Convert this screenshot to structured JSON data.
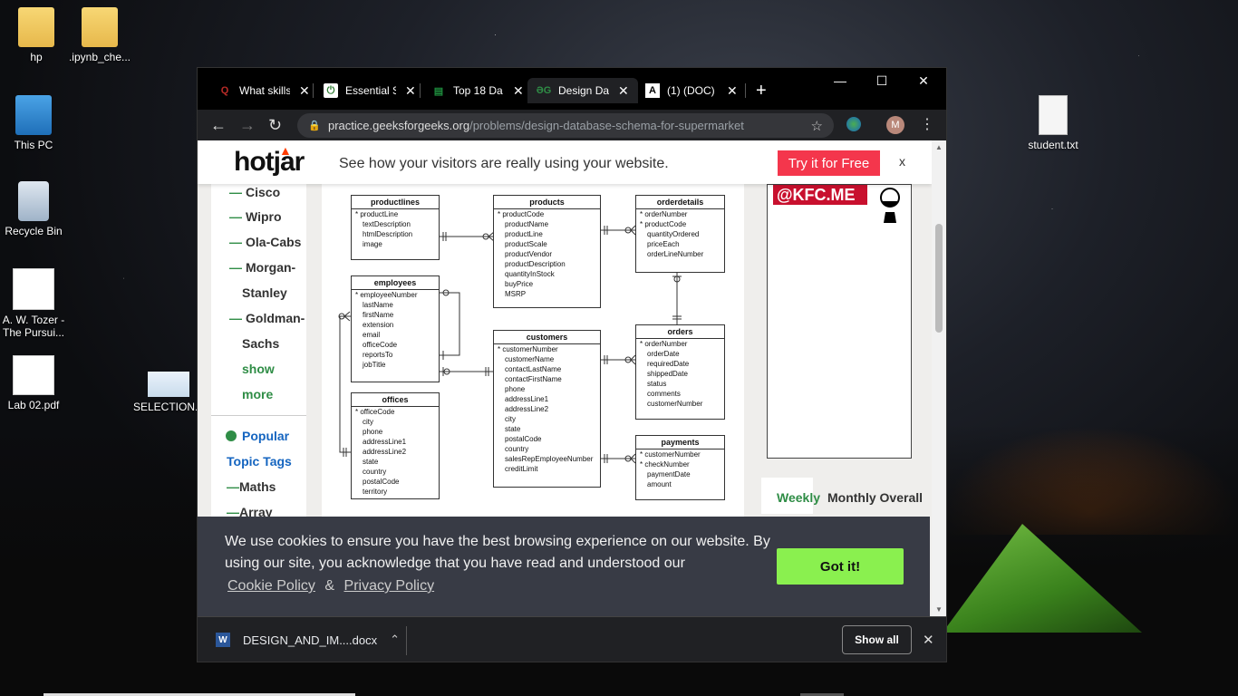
{
  "desktop": {
    "icons": [
      {
        "label": "hp"
      },
      {
        "label": ".ipynb_che..."
      },
      {
        "label": "This PC"
      },
      {
        "label": "Recycle Bin"
      },
      {
        "label": "A. W. Tozer - The Pursui..."
      },
      {
        "label": "Lab 02.pdf"
      },
      {
        "label": "SELECTION..."
      },
      {
        "label": "student.txt"
      }
    ]
  },
  "browser": {
    "tabs": [
      {
        "title": "What skills",
        "favicon": "Q",
        "color": "#b92b27"
      },
      {
        "title": "Essential S",
        "favicon": "⏻",
        "color": "#2e7d32"
      },
      {
        "title": "Top 18 Da",
        "favicon": "▤",
        "color": "#1e8e3e"
      },
      {
        "title": "Design Da",
        "favicon": "ƏG",
        "color": "#2f8d46"
      },
      {
        "title": "(1) (DOC)",
        "favicon": "A",
        "color": "#ffffff"
      }
    ],
    "new_tab": "+",
    "url_host": "practice.geeksforgeeks.org",
    "url_path": "/problems/design-database-schema-for-supermarket",
    "avatar": "M"
  },
  "hotjar": {
    "logo": "hotjar",
    "tagline": "See how your visitors are really using your website.",
    "cta": "Try it for Free",
    "close": "x"
  },
  "sidebar": {
    "companies": [
      "Cisco",
      "Wipro",
      "Ola-Cabs",
      "Morgan-",
      "Stanley",
      "Goldman-",
      "Sachs"
    ],
    "show_more_1": "show",
    "show_more_2": "more",
    "popular_1": "Popular",
    "popular_2": "Topic Tags",
    "topics": [
      "Maths",
      "Array"
    ]
  },
  "erd": {
    "productlines": {
      "title": "productlines",
      "fields": [
        {
          "n": "productLine",
          "pk": true
        },
        {
          "n": "textDescription"
        },
        {
          "n": "htmlDescription"
        },
        {
          "n": "image"
        }
      ]
    },
    "products": {
      "title": "products",
      "fields": [
        {
          "n": "productCode",
          "pk": true
        },
        {
          "n": "productName"
        },
        {
          "n": "productLine"
        },
        {
          "n": "productScale"
        },
        {
          "n": "productVendor"
        },
        {
          "n": "productDescription"
        },
        {
          "n": "quantityInStock"
        },
        {
          "n": "buyPrice"
        },
        {
          "n": "MSRP"
        }
      ]
    },
    "orderdetails": {
      "title": "orderdetails",
      "fields": [
        {
          "n": "orderNumber",
          "pk": true
        },
        {
          "n": "productCode",
          "pk": true
        },
        {
          "n": "quantityOrdered"
        },
        {
          "n": "priceEach"
        },
        {
          "n": "orderLineNumber"
        }
      ]
    },
    "employees": {
      "title": "employees",
      "fields": [
        {
          "n": "employeeNumber",
          "pk": true
        },
        {
          "n": "lastName"
        },
        {
          "n": "firstName"
        },
        {
          "n": "extension"
        },
        {
          "n": "email"
        },
        {
          "n": "officeCode"
        },
        {
          "n": "reportsTo"
        },
        {
          "n": "jobTitle"
        }
      ]
    },
    "customers": {
      "title": "customers",
      "fields": [
        {
          "n": "customerNumber",
          "pk": true
        },
        {
          "n": "customerName"
        },
        {
          "n": "contactLastName"
        },
        {
          "n": "contactFirstName"
        },
        {
          "n": "phone"
        },
        {
          "n": "addressLine1"
        },
        {
          "n": "addressLine2"
        },
        {
          "n": "city"
        },
        {
          "n": "state"
        },
        {
          "n": "postalCode"
        },
        {
          "n": "country"
        },
        {
          "n": "salesRepEmployeeNumber"
        },
        {
          "n": "creditLimit"
        }
      ]
    },
    "orders": {
      "title": "orders",
      "fields": [
        {
          "n": "orderNumber",
          "pk": true
        },
        {
          "n": "orderDate"
        },
        {
          "n": "requiredDate"
        },
        {
          "n": "shippedDate"
        },
        {
          "n": "status"
        },
        {
          "n": "comments"
        },
        {
          "n": "customerNumber"
        }
      ]
    },
    "offices": {
      "title": "offices",
      "fields": [
        {
          "n": "officeCode",
          "pk": true
        },
        {
          "n": "city"
        },
        {
          "n": "phone"
        },
        {
          "n": "addressLine1"
        },
        {
          "n": "addressLine2"
        },
        {
          "n": "state"
        },
        {
          "n": "country"
        },
        {
          "n": "postalCode"
        },
        {
          "n": "territory"
        }
      ]
    },
    "payments": {
      "title": "payments",
      "fields": [
        {
          "n": "customerNumber",
          "pk": true
        },
        {
          "n": "checkNumber",
          "pk": true
        },
        {
          "n": "paymentDate"
        },
        {
          "n": "amount"
        }
      ]
    }
  },
  "ad": {
    "text": "@KFC.ME"
  },
  "leaderboard": {
    "weekly": "Weekly",
    "monthly": "Monthly Overall"
  },
  "cookie": {
    "message": "We use cookies to ensure you have the best browsing experience on our website. By using our site, you acknowledge that you have read and understood our",
    "cookie_policy": "Cookie Policy",
    "amp": "&",
    "privacy_policy": "Privacy Policy",
    "button": "Got it!"
  },
  "downloads": {
    "file": "DESIGN_AND_IM....docx",
    "show_all": "Show all"
  }
}
